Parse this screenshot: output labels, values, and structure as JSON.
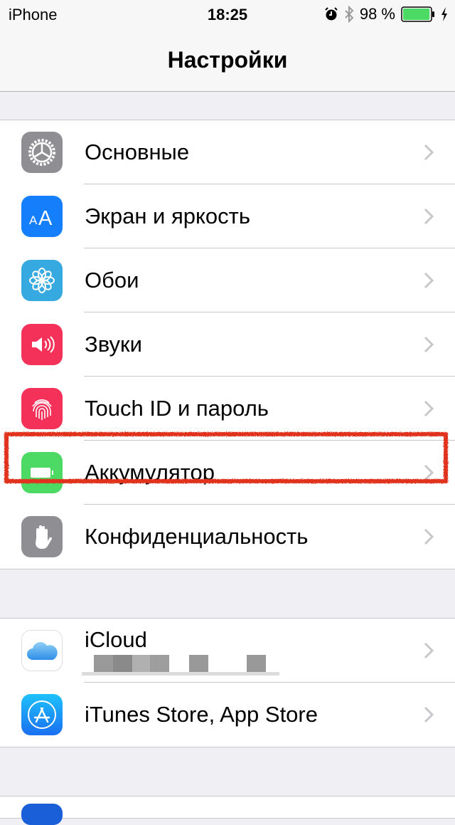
{
  "status_bar": {
    "carrier": "iPhone",
    "time": "18:25",
    "battery_percent_label": "98 %",
    "battery_level": 0.98,
    "icons": [
      "alarm-icon",
      "bluetooth-icon",
      "battery-icon",
      "charging-bolt-icon"
    ]
  },
  "nav": {
    "title": "Настройки"
  },
  "groups": [
    {
      "items": [
        {
          "label": "Основные",
          "icon": "gear-icon",
          "icon_color": "#8e8e93"
        },
        {
          "label": "Экран и яркость",
          "icon": "text-size-icon",
          "icon_color": "#147efb"
        },
        {
          "label": "Обои",
          "icon": "flower-icon",
          "icon_color": "#36a9e1"
        },
        {
          "label": "Звуки",
          "icon": "speaker-icon",
          "icon_color": "#f43159"
        },
        {
          "label": "Touch ID и пароль",
          "icon": "fingerprint-icon",
          "icon_color": "#f43159"
        },
        {
          "label": "Аккумулятор",
          "icon": "battery-icon",
          "icon_color": "#4cd964",
          "highlighted": true
        },
        {
          "label": "Конфиденциальность",
          "icon": "hand-icon",
          "icon_color": "#8e8e93"
        }
      ]
    },
    {
      "items": [
        {
          "label": "iCloud",
          "icon": "cloud-icon",
          "icon_color": "#ffffff",
          "subtitle_redacted": true
        },
        {
          "label": "iTunes Store, App Store",
          "icon": "app-store-icon",
          "icon_color": "#1c8ef9"
        }
      ]
    }
  ],
  "annotation": {
    "color": "#e0301e",
    "target": "Аккумулятор"
  }
}
